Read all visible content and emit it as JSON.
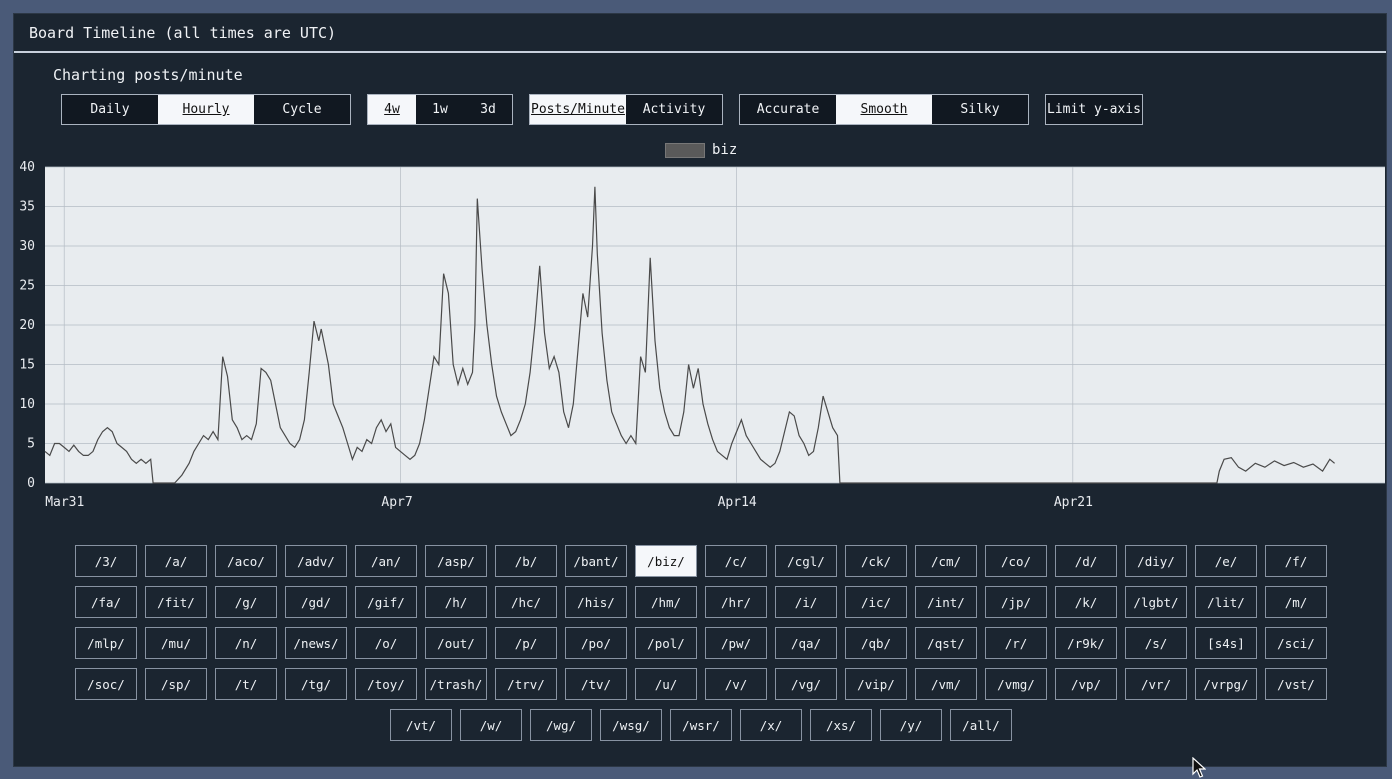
{
  "header": {
    "title": "Board Timeline (all times are UTC)"
  },
  "subtitle": "Charting posts/minute",
  "groups": {
    "period": [
      {
        "label": "Daily",
        "active": false
      },
      {
        "label": "Hourly",
        "active": true
      },
      {
        "label": "Cycle",
        "active": false
      }
    ],
    "range": [
      {
        "label": "4w",
        "active": true
      },
      {
        "label": "1w",
        "active": false
      },
      {
        "label": "3d",
        "active": false
      }
    ],
    "metric": [
      {
        "label": "Posts/Minute",
        "active": true
      },
      {
        "label": "Activity",
        "active": false
      }
    ],
    "smoothing": [
      {
        "label": "Accurate",
        "active": false
      },
      {
        "label": "Smooth",
        "active": true
      },
      {
        "label": "Silky",
        "active": false
      }
    ],
    "limit": [
      {
        "label": "Limit y-axis",
        "active": false
      }
    ]
  },
  "legend": {
    "series_name": "biz",
    "color": "#5a5a5a"
  },
  "chart_data": {
    "type": "line",
    "x_unit": "days since Mar31 00:00 UTC",
    "x_ticks": [
      {
        "label": "Mar31",
        "x": 0.0
      },
      {
        "label": "Apr7",
        "x": 7.0
      },
      {
        "label": "Apr14",
        "x": 14.0
      },
      {
        "label": "Apr21",
        "x": 21.0
      }
    ],
    "y_ticks": [
      0,
      5,
      10,
      15,
      20,
      25,
      30,
      35,
      40
    ],
    "ylim": [
      0,
      40
    ],
    "xlim": [
      -0.4,
      27.5
    ],
    "grid": true,
    "line_color": "#4a4a4a",
    "background": "#e8ecef",
    "series": [
      {
        "name": "biz",
        "points": [
          [
            -0.4,
            4.0
          ],
          [
            -0.3,
            3.5
          ],
          [
            -0.2,
            5.0
          ],
          [
            -0.1,
            5.0
          ],
          [
            0.0,
            4.5
          ],
          [
            0.1,
            4.0
          ],
          [
            0.2,
            4.8
          ],
          [
            0.3,
            4.0
          ],
          [
            0.4,
            3.5
          ],
          [
            0.5,
            3.5
          ],
          [
            0.6,
            4.0
          ],
          [
            0.7,
            5.5
          ],
          [
            0.8,
            6.5
          ],
          [
            0.9,
            7.0
          ],
          [
            1.0,
            6.5
          ],
          [
            1.1,
            5.0
          ],
          [
            1.2,
            4.5
          ],
          [
            1.3,
            4.0
          ],
          [
            1.4,
            3.0
          ],
          [
            1.5,
            2.5
          ],
          [
            1.6,
            3.0
          ],
          [
            1.7,
            2.5
          ],
          [
            1.8,
            3.0
          ],
          [
            1.85,
            0.0
          ],
          [
            2.3,
            0.0
          ],
          [
            2.45,
            1.0
          ],
          [
            2.6,
            2.5
          ],
          [
            2.7,
            4.0
          ],
          [
            2.8,
            5.0
          ],
          [
            2.9,
            6.0
          ],
          [
            3.0,
            5.5
          ],
          [
            3.1,
            6.5
          ],
          [
            3.2,
            5.5
          ],
          [
            3.3,
            16.0
          ],
          [
            3.4,
            13.5
          ],
          [
            3.5,
            8.0
          ],
          [
            3.6,
            7.0
          ],
          [
            3.7,
            5.5
          ],
          [
            3.8,
            6.0
          ],
          [
            3.9,
            5.5
          ],
          [
            4.0,
            7.5
          ],
          [
            4.1,
            14.5
          ],
          [
            4.2,
            14.0
          ],
          [
            4.3,
            13.0
          ],
          [
            4.4,
            10.0
          ],
          [
            4.5,
            7.0
          ],
          [
            4.6,
            6.0
          ],
          [
            4.7,
            5.0
          ],
          [
            4.8,
            4.5
          ],
          [
            4.9,
            5.5
          ],
          [
            5.0,
            8.0
          ],
          [
            5.1,
            14.0
          ],
          [
            5.2,
            20.5
          ],
          [
            5.3,
            18.0
          ],
          [
            5.35,
            19.5
          ],
          [
            5.5,
            15.0
          ],
          [
            5.6,
            10.0
          ],
          [
            5.7,
            8.5
          ],
          [
            5.8,
            7.0
          ],
          [
            5.9,
            5.0
          ],
          [
            6.0,
            3.0
          ],
          [
            6.1,
            4.5
          ],
          [
            6.2,
            4.0
          ],
          [
            6.3,
            5.5
          ],
          [
            6.4,
            5.0
          ],
          [
            6.5,
            7.0
          ],
          [
            6.6,
            8.0
          ],
          [
            6.7,
            6.5
          ],
          [
            6.8,
            7.5
          ],
          [
            6.9,
            4.5
          ],
          [
            7.0,
            4.0
          ],
          [
            7.1,
            3.5
          ],
          [
            7.2,
            3.0
          ],
          [
            7.3,
            3.5
          ],
          [
            7.4,
            5.0
          ],
          [
            7.5,
            8.0
          ],
          [
            7.6,
            12.0
          ],
          [
            7.7,
            16.0
          ],
          [
            7.8,
            15.0
          ],
          [
            7.9,
            26.5
          ],
          [
            8.0,
            24.0
          ],
          [
            8.1,
            15.0
          ],
          [
            8.2,
            12.5
          ],
          [
            8.3,
            14.5
          ],
          [
            8.4,
            12.5
          ],
          [
            8.5,
            14.0
          ],
          [
            8.55,
            20.0
          ],
          [
            8.6,
            36.0
          ],
          [
            8.7,
            27.0
          ],
          [
            8.8,
            20.0
          ],
          [
            8.9,
            15.0
          ],
          [
            9.0,
            11.0
          ],
          [
            9.1,
            9.0
          ],
          [
            9.2,
            7.5
          ],
          [
            9.3,
            6.0
          ],
          [
            9.4,
            6.5
          ],
          [
            9.5,
            8.0
          ],
          [
            9.6,
            10.0
          ],
          [
            9.7,
            14.0
          ],
          [
            9.8,
            20.0
          ],
          [
            9.9,
            27.5
          ],
          [
            10.0,
            19.0
          ],
          [
            10.1,
            14.5
          ],
          [
            10.2,
            16.0
          ],
          [
            10.3,
            14.0
          ],
          [
            10.4,
            9.0
          ],
          [
            10.5,
            7.0
          ],
          [
            10.6,
            10.0
          ],
          [
            10.7,
            17.0
          ],
          [
            10.8,
            24.0
          ],
          [
            10.9,
            21.0
          ],
          [
            11.0,
            30.0
          ],
          [
            11.05,
            37.5
          ],
          [
            11.1,
            29.0
          ],
          [
            11.2,
            19.0
          ],
          [
            11.3,
            13.0
          ],
          [
            11.4,
            9.0
          ],
          [
            11.5,
            7.5
          ],
          [
            11.6,
            6.0
          ],
          [
            11.7,
            5.0
          ],
          [
            11.8,
            6.0
          ],
          [
            11.9,
            5.0
          ],
          [
            12.0,
            16.0
          ],
          [
            12.1,
            14.0
          ],
          [
            12.2,
            28.5
          ],
          [
            12.3,
            18.0
          ],
          [
            12.4,
            12.0
          ],
          [
            12.5,
            9.0
          ],
          [
            12.6,
            7.0
          ],
          [
            12.7,
            6.0
          ],
          [
            12.8,
            6.0
          ],
          [
            12.9,
            9.0
          ],
          [
            13.0,
            15.0
          ],
          [
            13.1,
            12.0
          ],
          [
            13.2,
            14.5
          ],
          [
            13.3,
            10.0
          ],
          [
            13.4,
            7.5
          ],
          [
            13.5,
            5.5
          ],
          [
            13.6,
            4.0
          ],
          [
            13.7,
            3.5
          ],
          [
            13.8,
            3.0
          ],
          [
            13.9,
            5.0
          ],
          [
            14.0,
            6.5
          ],
          [
            14.1,
            8.0
          ],
          [
            14.2,
            6.0
          ],
          [
            14.3,
            5.0
          ],
          [
            14.4,
            4.0
          ],
          [
            14.5,
            3.0
          ],
          [
            14.6,
            2.5
          ],
          [
            14.7,
            2.0
          ],
          [
            14.8,
            2.5
          ],
          [
            14.9,
            4.0
          ],
          [
            15.0,
            6.5
          ],
          [
            15.1,
            9.0
          ],
          [
            15.2,
            8.5
          ],
          [
            15.3,
            6.0
          ],
          [
            15.4,
            5.0
          ],
          [
            15.5,
            3.5
          ],
          [
            15.6,
            4.0
          ],
          [
            15.7,
            7.0
          ],
          [
            15.8,
            11.0
          ],
          [
            15.9,
            9.0
          ],
          [
            16.0,
            7.0
          ],
          [
            16.1,
            6.0
          ],
          [
            16.15,
            0.0
          ],
          [
            24.0,
            0.0
          ],
          [
            24.05,
            1.5
          ],
          [
            24.15,
            3.0
          ],
          [
            24.3,
            3.2
          ],
          [
            24.45,
            2.0
          ],
          [
            24.6,
            1.5
          ],
          [
            24.8,
            2.5
          ],
          [
            25.0,
            2.0
          ],
          [
            25.2,
            2.8
          ],
          [
            25.4,
            2.2
          ],
          [
            25.6,
            2.6
          ],
          [
            25.8,
            2.0
          ],
          [
            26.0,
            2.4
          ],
          [
            26.2,
            1.5
          ],
          [
            26.35,
            3.0
          ],
          [
            26.45,
            2.5
          ]
        ]
      }
    ]
  },
  "boards": {
    "rows": [
      [
        "/3/",
        "/a/",
        "/aco/",
        "/adv/",
        "/an/",
        "/asp/",
        "/b/",
        "/bant/",
        "/biz/",
        "/c/",
        "/cgl/",
        "/ck/",
        "/cm/",
        "/co/",
        "/d/",
        "/diy/",
        "/e/",
        "/f/"
      ],
      [
        "/fa/",
        "/fit/",
        "/g/",
        "/gd/",
        "/gif/",
        "/h/",
        "/hc/",
        "/his/",
        "/hm/",
        "/hr/",
        "/i/",
        "/ic/",
        "/int/",
        "/jp/",
        "/k/",
        "/lgbt/",
        "/lit/",
        "/m/"
      ],
      [
        "/mlp/",
        "/mu/",
        "/n/",
        "/news/",
        "/o/",
        "/out/",
        "/p/",
        "/po/",
        "/pol/",
        "/pw/",
        "/qa/",
        "/qb/",
        "/qst/",
        "/r/",
        "/r9k/",
        "/s/",
        "[s4s]",
        "/sci/"
      ],
      [
        "/soc/",
        "/sp/",
        "/t/",
        "/tg/",
        "/toy/",
        "/trash/",
        "/trv/",
        "/tv/",
        "/u/",
        "/v/",
        "/vg/",
        "/vip/",
        "/vm/",
        "/vmg/",
        "/vp/",
        "/vr/",
        "/vrpg/",
        "/vst/"
      ],
      [
        "/vt/",
        "/w/",
        "/wg/",
        "/wsg/",
        "/wsr/",
        "/x/",
        "/xs/",
        "/y/",
        "/all/"
      ]
    ],
    "active": "/biz/"
  }
}
